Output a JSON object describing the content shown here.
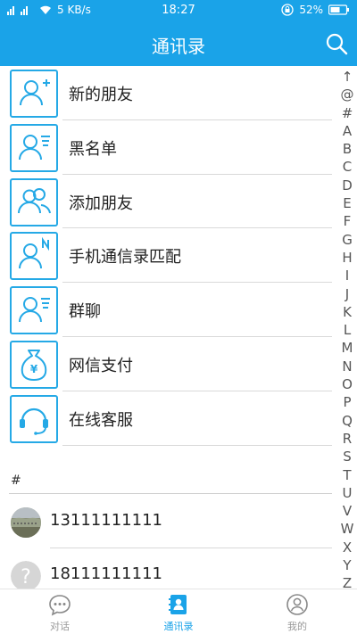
{
  "status_bar": {
    "network": "5 KB/s",
    "time": "18:27",
    "battery": "52%"
  },
  "header": {
    "title": "通讯录",
    "search_icon": "search-icon"
  },
  "menu": [
    {
      "label": "新的朋友",
      "icon": "add-user-icon"
    },
    {
      "label": "黑名单",
      "icon": "blocked-list-icon"
    },
    {
      "label": "添加朋友",
      "icon": "group-icon"
    },
    {
      "label": "手机通信录匹配",
      "icon": "phone-contacts-icon"
    },
    {
      "label": "群聊",
      "icon": "group-chat-icon"
    },
    {
      "label": "网信支付",
      "icon": "money-bag-icon"
    },
    {
      "label": "在线客服",
      "icon": "headset-icon"
    }
  ],
  "section_header": "#",
  "contacts": [
    {
      "number": "13111111111"
    },
    {
      "number": "18111111111"
    }
  ],
  "index_letters": [
    "↑",
    "@",
    "#",
    "A",
    "B",
    "C",
    "D",
    "E",
    "F",
    "G",
    "H",
    "I",
    "J",
    "K",
    "L",
    "M",
    "N",
    "O",
    "P",
    "Q",
    "R",
    "S",
    "T",
    "U",
    "V",
    "W",
    "X",
    "Y",
    "Z"
  ],
  "tabs": [
    {
      "label": "对话",
      "icon": "chat-icon",
      "active": false
    },
    {
      "label": "通讯录",
      "icon": "contacts-icon",
      "active": true
    },
    {
      "label": "我的",
      "icon": "profile-icon",
      "active": false
    }
  ],
  "colors": {
    "accent": "#1aa3e8",
    "icon_border": "#25a9e6"
  }
}
